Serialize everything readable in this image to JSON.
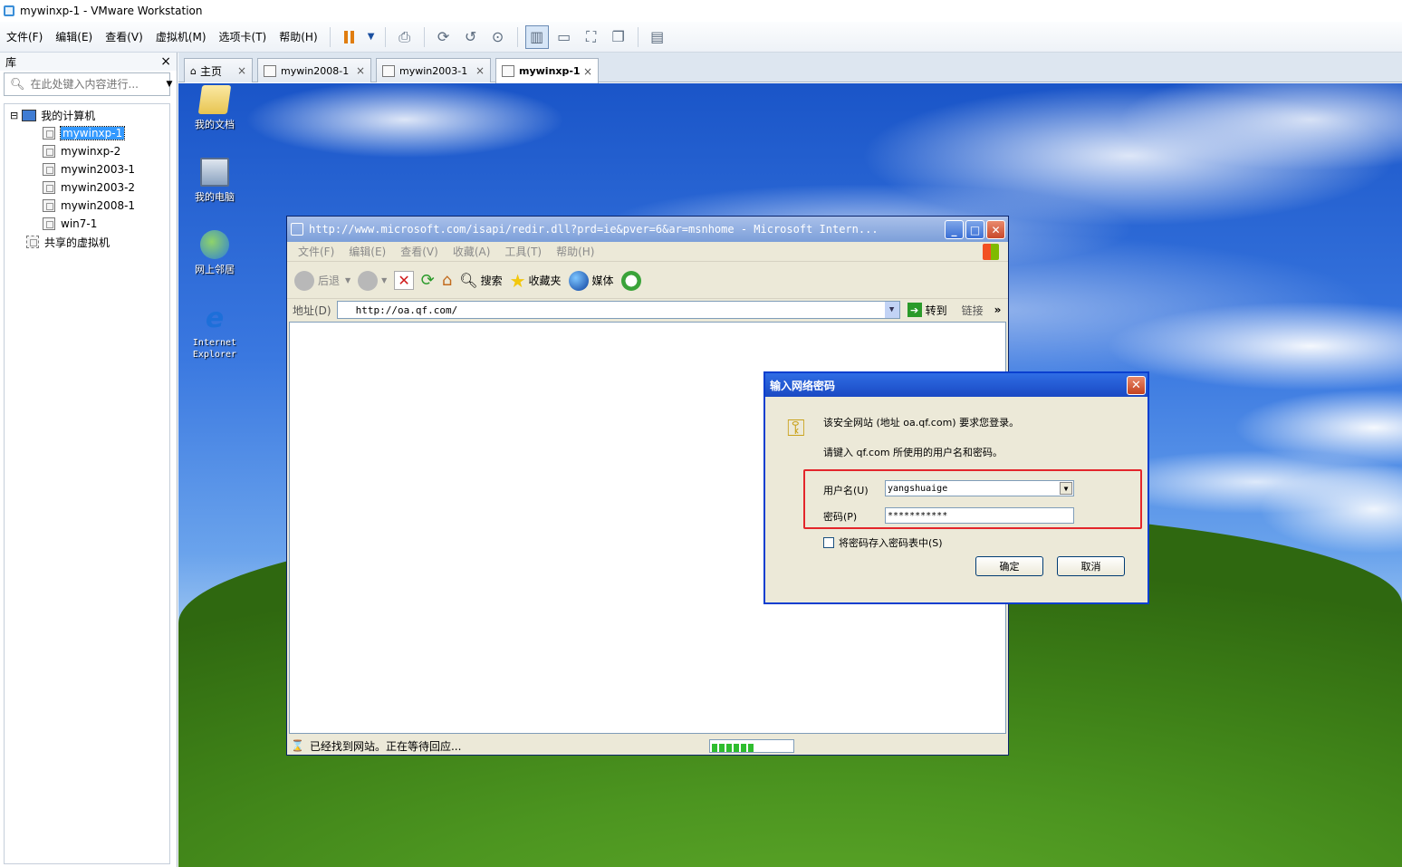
{
  "window": {
    "title": "mywinxp-1 - VMware Workstation"
  },
  "menubar": {
    "items": [
      "文件(F)",
      "编辑(E)",
      "查看(V)",
      "虚拟机(M)",
      "选项卡(T)",
      "帮助(H)"
    ]
  },
  "library": {
    "header": "库",
    "close": "×",
    "search_placeholder": "在此处键入内容进行...",
    "tree": {
      "root": "我的计算机",
      "vms": [
        "mywinxp-1",
        "mywinxp-2",
        "mywin2003-1",
        "mywin2003-2",
        "mywin2008-1",
        "win7-1"
      ],
      "shared": "共享的虚拟机",
      "expander": "⊟"
    }
  },
  "tabs": [
    {
      "label": "主页",
      "close": "×"
    },
    {
      "label": "mywin2008-1",
      "close": "×"
    },
    {
      "label": "mywin2003-1",
      "close": "×"
    },
    {
      "label": "mywinxp-1",
      "close": "×"
    }
  ],
  "desktop": {
    "icons": [
      "我的文档",
      "我的电脑",
      "网上邻居",
      "Internet Explorer"
    ]
  },
  "ie": {
    "title": "http://www.microsoft.com/isapi/redir.dll?prd=ie&pver=6&ar=msnhome - Microsoft Intern...",
    "menu": [
      "文件(F)",
      "编辑(E)",
      "查看(V)",
      "收藏(A)",
      "工具(T)",
      "帮助(H)"
    ],
    "toolbar": {
      "back": "后退",
      "search": "搜索",
      "favorites": "收藏夹",
      "media": "媒体"
    },
    "address_label": "地址(D)",
    "address": "http://oa.qf.com/",
    "go": "转到",
    "links": "链接",
    "status": "已经找到网站。正在等待回应...",
    "progress": 0.55
  },
  "dialog": {
    "title": "输入网络密码",
    "close": "✕",
    "line1": "该安全网站 (地址 oa.qf.com) 要求您登录。",
    "line2": "请键入 qf.com 所使用的用户名和密码。",
    "username_label": "用户名(U)",
    "username": "yangshuaige",
    "password_label": "密码(P)",
    "password": "***********",
    "save_label": "将密码存入密码表中(S)",
    "ok": "确定",
    "cancel": "取消"
  },
  "colors": {
    "xp_title": "#1a49c3",
    "highlight_box": "#e3262b",
    "vmware_accent": "#3399ff"
  }
}
